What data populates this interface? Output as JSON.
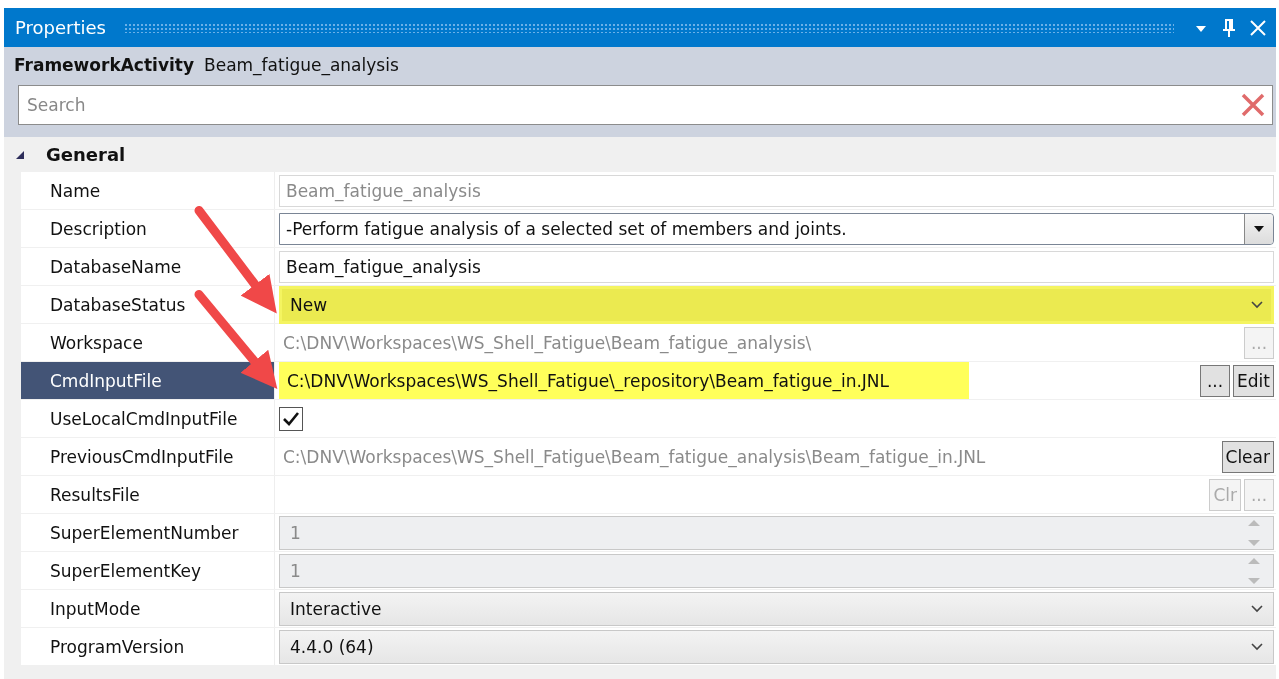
{
  "window": {
    "title": "Properties"
  },
  "object": {
    "type": "FrameworkActivity",
    "name": "Beam_fatigue_analysis"
  },
  "search": {
    "placeholder": "Search"
  },
  "category": {
    "label": "General",
    "expanded": true
  },
  "properties": [
    {
      "label": "Name",
      "kind": "text",
      "value": "Beam_fatigue_analysis",
      "disabled": true,
      "selected": false,
      "highlighted": false
    },
    {
      "label": "Description",
      "kind": "combo",
      "value": "-Perform fatigue analysis of a selected set of members and joints.",
      "disabled": false,
      "selected": false,
      "highlighted": false
    },
    {
      "label": "DatabaseName",
      "kind": "text",
      "value": "Beam_fatigue_analysis",
      "disabled": false,
      "selected": false,
      "highlighted": false
    },
    {
      "label": "DatabaseStatus",
      "kind": "dropdown",
      "value": "New",
      "disabled": false,
      "selected": false,
      "highlighted": true
    },
    {
      "label": "Workspace",
      "kind": "path",
      "value": "C:\\DNV\\Workspaces\\WS_Shell_Fatigue\\Beam_fatigue_analysis\\",
      "disabled": true,
      "selected": false,
      "highlighted": false,
      "buttons": [
        {
          "label": "...",
          "disabled": true
        }
      ]
    },
    {
      "label": "CmdInputFile",
      "kind": "path",
      "value": "C:\\DNV\\Workspaces\\WS_Shell_Fatigue\\_repository\\Beam_fatigue_in.JNL",
      "disabled": false,
      "selected": true,
      "highlighted": true,
      "buttons": [
        {
          "label": "...",
          "disabled": false
        },
        {
          "label": "Edit",
          "disabled": false
        }
      ]
    },
    {
      "label": "UseLocalCmdInputFile",
      "kind": "check",
      "checked": true,
      "selected": false,
      "highlighted": false
    },
    {
      "label": "PreviousCmdInputFile",
      "kind": "path",
      "value": "C:\\DNV\\Workspaces\\WS_Shell_Fatigue\\Beam_fatigue_analysis\\Beam_fatigue_in.JNL",
      "disabled": true,
      "selected": false,
      "highlighted": false,
      "buttons": [
        {
          "label": "Clear",
          "disabled": false
        }
      ]
    },
    {
      "label": "ResultsFile",
      "kind": "path",
      "disabled": true,
      "selected": false,
      "highlighted": false,
      "buttons": [
        {
          "label": "Clr",
          "disabled": true
        },
        {
          "label": "...",
          "disabled": true
        }
      ]
    },
    {
      "label": "SuperElementNumber",
      "kind": "spinner",
      "value": "1",
      "disabled": true,
      "selected": false,
      "highlighted": false
    },
    {
      "label": "SuperElementKey",
      "kind": "spinner",
      "value": "1",
      "disabled": true,
      "selected": false,
      "highlighted": false
    },
    {
      "label": "InputMode",
      "kind": "dropdown",
      "value": "Interactive",
      "disabled": false,
      "selected": false,
      "highlighted": false
    },
    {
      "label": "ProgramVersion",
      "kind": "dropdown",
      "value": "4.4.0 (64)",
      "disabled": false,
      "selected": false,
      "highlighted": false
    }
  ]
}
